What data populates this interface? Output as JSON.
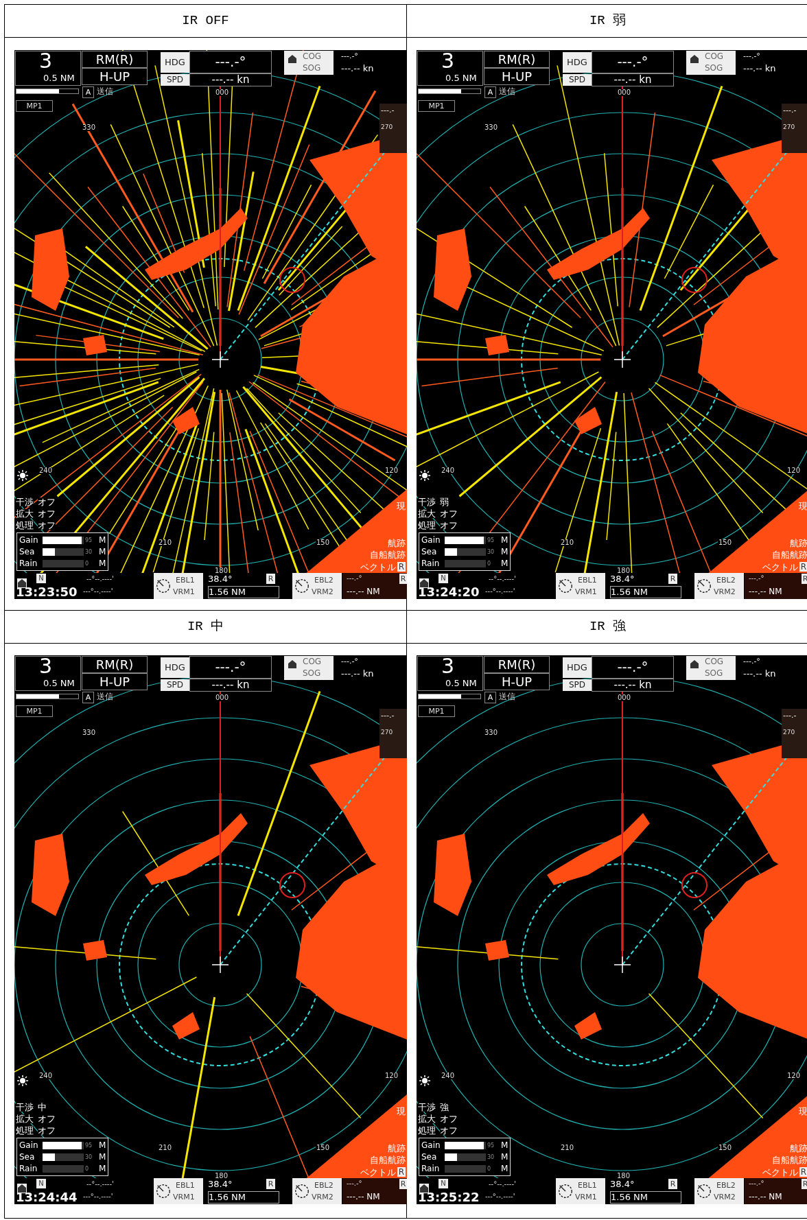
{
  "table": {
    "rows": [
      {
        "cells": [
          {
            "heading": "IR OFF",
            "radar": {
              "range": "3",
              "range_scale": "0.5 NM",
              "motion": "RM(R)",
              "orientation": "H-UP",
              "tune_mode": "A",
              "tx_status": "送信",
              "mark": "MP1",
              "hdg_label": "HDG",
              "hdg_value": "---.-°",
              "spd_label": "SPD",
              "spd_value": "---.-- kn",
              "cog_label": "COG",
              "sog_label": "SOG",
              "cog_value": "---.-°",
              "sog_value": "---.-- kn",
              "compass_value": "---.-",
              "compass_bearing": "270",
              "bearings": [
                "000",
                "330",
                "240",
                "210",
                "180",
                "150",
                "120"
              ],
              "settings": [
                {
                  "label": "干渉",
                  "value": "オフ"
                },
                {
                  "label": "拡大",
                  "value": "オフ"
                },
                {
                  "label": "処理",
                  "value": "オフ"
                }
              ],
              "adjustments": [
                {
                  "label": "Gain",
                  "level": 0.95,
                  "reading": "95",
                  "mode": "M"
                },
                {
                  "label": "Sea",
                  "level": 0.3,
                  "reading": "30",
                  "mode": "M"
                },
                {
                  "label": "Rain",
                  "reading": "0",
                  "mode": "M"
                }
              ],
              "right_labels": [
                "現",
                "航跡",
                "自船航跡"
              ],
              "vector_label": "ベクトル",
              "vector_mode": "R",
              "north": "N",
              "time": "13:23:50",
              "position_lat": "--°--.----'",
              "position_lon": "---°--.----'",
              "ebl1": "EBL1",
              "vrm1": "VRM1",
              "ebl1_value": "38.4°",
              "ebl1_mode": "R",
              "vrm1_value": "1.56 NM",
              "ebl2": "EBL2",
              "vrm2": "VRM2",
              "ebl2_value": "---.-°",
              "vrm2_value": "---.-- NM",
              "ebl2_mode": "R"
            }
          },
          {
            "heading": "IR 弱",
            "radar": {
              "range": "3",
              "range_scale": "0.5 NM",
              "motion": "RM(R)",
              "orientation": "H-UP",
              "tune_mode": "A",
              "tx_status": "送信",
              "mark": "MP1",
              "hdg_label": "HDG",
              "hdg_value": "---.-°",
              "spd_label": "SPD",
              "spd_value": "---.-- kn",
              "cog_label": "COG",
              "sog_label": "SOG",
              "cog_value": "---.-°",
              "sog_value": "---.-- kn",
              "compass_value": "---.-",
              "compass_bearing": "270",
              "bearings": [
                "000",
                "330",
                "240",
                "210",
                "180",
                "150",
                "120"
              ],
              "settings": [
                {
                  "label": "干渉",
                  "value": "弱"
                },
                {
                  "label": "拡大",
                  "value": "オフ"
                },
                {
                  "label": "処理",
                  "value": "オフ"
                }
              ],
              "adjustments": [
                {
                  "label": "Gain",
                  "level": 0.95,
                  "reading": "95",
                  "mode": "M"
                },
                {
                  "label": "Sea",
                  "level": 0.3,
                  "reading": "30",
                  "mode": "M"
                },
                {
                  "label": "Rain",
                  "reading": "0",
                  "mode": "M"
                }
              ],
              "right_labels": [
                "現",
                "航跡",
                "自船航跡"
              ],
              "vector_label": "ベクトル",
              "vector_mode": "R",
              "north": "N",
              "time": "13:24:20",
              "position_lat": "--°--.----'",
              "position_lon": "---°--.----'",
              "ebl1": "EBL1",
              "vrm1": "VRM1",
              "ebl1_value": "38.4°",
              "ebl1_mode": "R",
              "vrm1_value": "1.56 NM",
              "ebl2": "EBL2",
              "vrm2": "VRM2",
              "ebl2_value": "---.-°",
              "vrm2_value": "---.-- NM",
              "ebl2_mode": "R"
            }
          }
        ]
      },
      {
        "cells": [
          {
            "heading": "IR 中",
            "radar": {
              "range": "3",
              "range_scale": "0.5 NM",
              "motion": "RM(R)",
              "orientation": "H-UP",
              "tune_mode": "A",
              "tx_status": "送信",
              "mark": "MP1",
              "hdg_label": "HDG",
              "hdg_value": "---.-°",
              "spd_label": "SPD",
              "spd_value": "---.-- kn",
              "cog_label": "COG",
              "sog_label": "SOG",
              "cog_value": "---.-°",
              "sog_value": "---.-- kn",
              "compass_value": "---.-",
              "compass_bearing": "270",
              "bearings": [
                "000",
                "330",
                "240",
                "210",
                "180",
                "150",
                "120"
              ],
              "settings": [
                {
                  "label": "干渉",
                  "value": "中"
                },
                {
                  "label": "拡大",
                  "value": "オフ"
                },
                {
                  "label": "処理",
                  "value": "オフ"
                }
              ],
              "adjustments": [
                {
                  "label": "Gain",
                  "level": 0.95,
                  "reading": "95",
                  "mode": "M"
                },
                {
                  "label": "Sea",
                  "level": 0.3,
                  "reading": "30",
                  "mode": "M"
                },
                {
                  "label": "Rain",
                  "reading": "0",
                  "mode": "M"
                }
              ],
              "right_labels": [
                "現",
                "航跡",
                "自船航跡"
              ],
              "vector_label": "ベクトル",
              "vector_mode": "R",
              "north": "N",
              "time": "13:24:44",
              "position_lat": "--°--.----'",
              "position_lon": "---°--.----'",
              "ebl1": "EBL1",
              "vrm1": "VRM1",
              "ebl1_value": "38.4°",
              "ebl1_mode": "R",
              "vrm1_value": "1.56 NM",
              "ebl2": "EBL2",
              "vrm2": "VRM2",
              "ebl2_value": "---.-°",
              "vrm2_value": "---.-- NM",
              "ebl2_mode": "R"
            }
          },
          {
            "heading": "IR 強",
            "radar": {
              "range": "3",
              "range_scale": "0.5 NM",
              "motion": "RM(R)",
              "orientation": "H-UP",
              "tune_mode": "A",
              "tx_status": "送信",
              "mark": "MP1",
              "hdg_label": "HDG",
              "hdg_value": "---.-°",
              "spd_label": "SPD",
              "spd_value": "---.-- kn",
              "cog_label": "COG",
              "sog_label": "SOG",
              "cog_value": "---.-°",
              "sog_value": "---.-- kn",
              "compass_value": "---.-",
              "compass_bearing": "270",
              "bearings": [
                "000",
                "330",
                "240",
                "210",
                "180",
                "150",
                "120"
              ],
              "settings": [
                {
                  "label": "干渉",
                  "value": "強"
                },
                {
                  "label": "拡大",
                  "value": "オフ"
                },
                {
                  "label": "処理",
                  "value": "オフ"
                }
              ],
              "adjustments": [
                {
                  "label": "Gain",
                  "level": 0.95,
                  "reading": "95",
                  "mode": "M"
                },
                {
                  "label": "Sea",
                  "level": 0.3,
                  "reading": "30",
                  "mode": "M"
                },
                {
                  "label": "Rain",
                  "reading": "0",
                  "mode": "M"
                }
              ],
              "right_labels": [
                "現",
                "航跡",
                "自船航跡"
              ],
              "vector_label": "ベクトル",
              "vector_mode": "R",
              "north": "N",
              "time": "13:25:22",
              "position_lat": "--°--.----'",
              "position_lon": "---°--.----'",
              "ebl1": "EBL1",
              "vrm1": "VRM1",
              "ebl1_value": "38.4°",
              "ebl1_mode": "R",
              "vrm1_value": "1.56 NM",
              "ebl2": "EBL2",
              "vrm2": "VRM2",
              "ebl2_value": "---.-°",
              "vrm2_value": "---.-- NM",
              "ebl2_mode": "R"
            }
          }
        ]
      }
    ]
  }
}
